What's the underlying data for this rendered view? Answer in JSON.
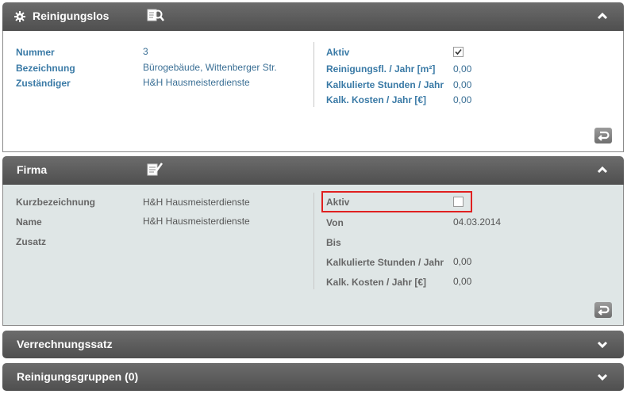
{
  "reinigungslos": {
    "title": "Reinigungslos",
    "left": [
      {
        "label": "Nummer",
        "value": "3"
      },
      {
        "label": "Bezeichnung",
        "value": "Bürogebäude, Wittenberger Str."
      },
      {
        "label": "Zuständiger",
        "value": "H&H Hausmeisterdienste"
      }
    ],
    "right": [
      {
        "label": "Aktiv",
        "value": ""
      },
      {
        "label": "Reinigungsfl. / Jahr [m²]",
        "value": "0,00"
      },
      {
        "label": "Kalkulierte Stunden / Jahr",
        "value": "0,00"
      },
      {
        "label": "Kalk. Kosten / Jahr [€]",
        "value": "0,00"
      }
    ],
    "aktiv_checked": true
  },
  "firma": {
    "title": "Firma",
    "left": [
      {
        "label": "Kurzbezeichnung",
        "value": "H&H Hausmeisterdienste"
      },
      {
        "label": "Name",
        "value": "H&H Hausmeisterdienste"
      },
      {
        "label": "Zusatz",
        "value": ""
      }
    ],
    "right": [
      {
        "label": "Aktiv",
        "value": ""
      },
      {
        "label": "Von",
        "value": "04.03.2014"
      },
      {
        "label": "Bis",
        "value": ""
      },
      {
        "label": "Kalkulierte Stunden / Jahr",
        "value": "0,00"
      },
      {
        "label": "Kalk. Kosten / Jahr [€]",
        "value": "0,00"
      }
    ],
    "aktiv_checked": false
  },
  "verrechnungssatz": {
    "title": "Verrechnungssatz"
  },
  "reinigungsgruppen": {
    "title": "Reinigungsgruppen (0)"
  },
  "colors": {
    "header": "#5a5a5a",
    "label_blue": "#3a7aa6",
    "firma_bg": "#dfe6e6",
    "highlight": "#e02020"
  }
}
